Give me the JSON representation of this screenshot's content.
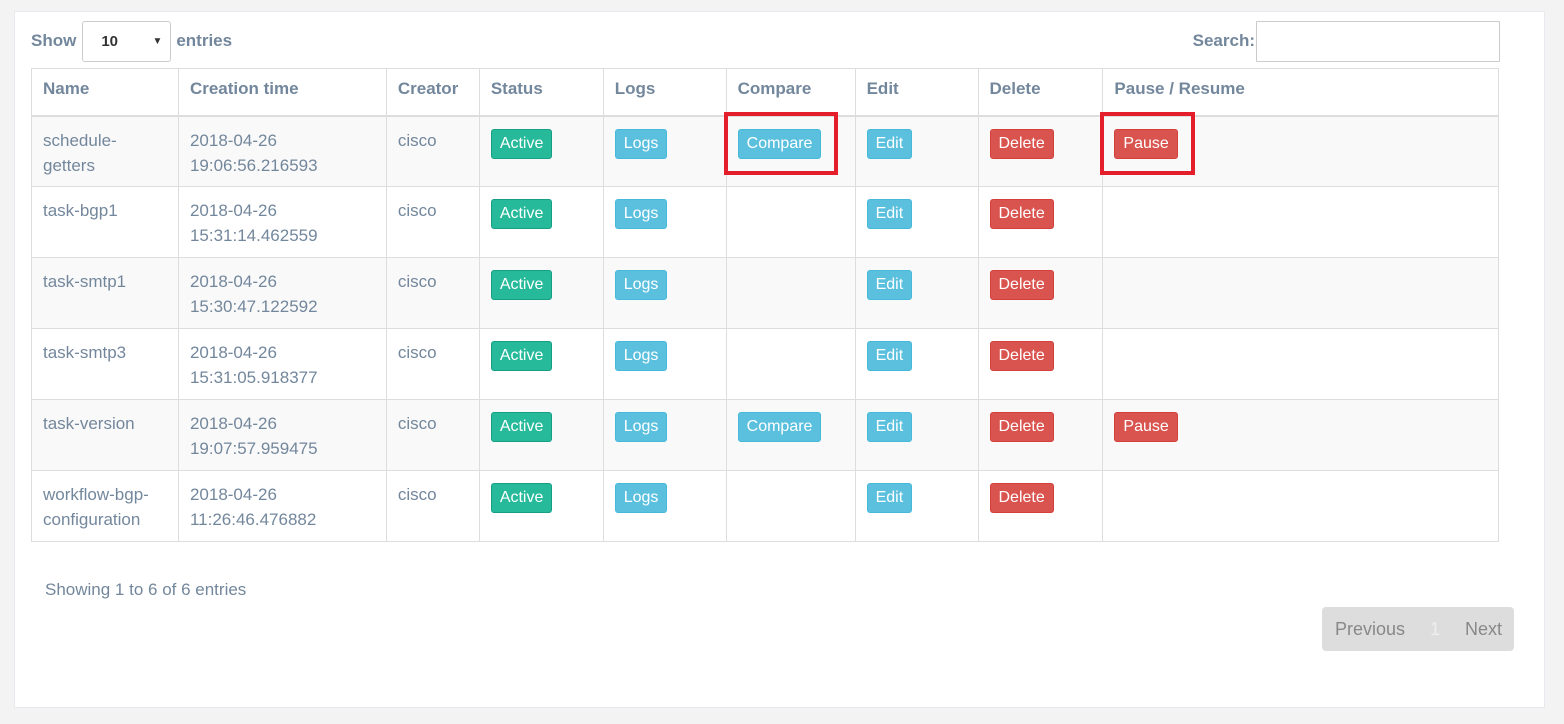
{
  "length": {
    "show_label": "Show",
    "value": "10",
    "entries_label": "entries",
    "caret_icon": "chevron-down-icon"
  },
  "search": {
    "label": "Search:",
    "value": "",
    "placeholder": ""
  },
  "table": {
    "headers": [
      "Name",
      "Creation time",
      "Creator",
      "Status",
      "Logs",
      "Compare",
      "Edit",
      "Delete",
      "Pause / Resume"
    ],
    "rows": [
      {
        "name": "schedule-getters",
        "time_date": "2018-04-26",
        "time_clock": "19:06:56.216593",
        "creator": "cisco",
        "status": "Active",
        "logs": "Logs",
        "compare": "Compare",
        "edit": "Edit",
        "delete": "Delete",
        "pause": "Pause"
      },
      {
        "name": "task-bgp1",
        "time_date": "2018-04-26",
        "time_clock": "15:31:14.462559",
        "creator": "cisco",
        "status": "Active",
        "logs": "Logs",
        "compare": "",
        "edit": "Edit",
        "delete": "Delete",
        "pause": ""
      },
      {
        "name": "task-smtp1",
        "time_date": "2018-04-26",
        "time_clock": "15:30:47.122592",
        "creator": "cisco",
        "status": "Active",
        "logs": "Logs",
        "compare": "",
        "edit": "Edit",
        "delete": "Delete",
        "pause": ""
      },
      {
        "name": "task-smtp3",
        "time_date": "2018-04-26",
        "time_clock": "15:31:05.918377",
        "creator": "cisco",
        "status": "Active",
        "logs": "Logs",
        "compare": "",
        "edit": "Edit",
        "delete": "Delete",
        "pause": ""
      },
      {
        "name": "task-version",
        "time_date": "2018-04-26",
        "time_clock": "19:07:57.959475",
        "creator": "cisco",
        "status": "Active",
        "logs": "Logs",
        "compare": "Compare",
        "edit": "Edit",
        "delete": "Delete",
        "pause": "Pause"
      },
      {
        "name": "workflow-bgp-configuration",
        "time_date": "2018-04-26",
        "time_clock": "11:26:46.476882",
        "creator": "cisco",
        "status": "Active",
        "logs": "Logs",
        "compare": "",
        "edit": "Edit",
        "delete": "Delete",
        "pause": ""
      }
    ]
  },
  "info": "Showing 1 to 6 of 6 entries",
  "pagination": {
    "previous": "Previous",
    "current": "1",
    "next": "Next"
  },
  "colors": {
    "success": "#26b99a",
    "info": "#5bc0de",
    "danger": "#d9534f",
    "highlight": "#e41e2a"
  }
}
